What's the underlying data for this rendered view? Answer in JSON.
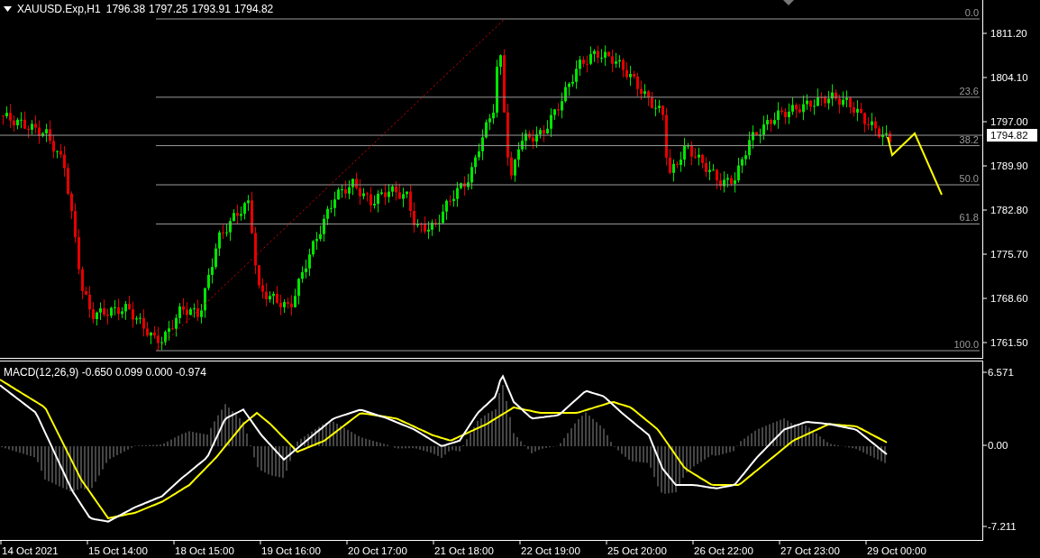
{
  "chart_header": {
    "instrument": "XAUUSD.Exp,H1",
    "ohlc": [
      "1796.38",
      "1797.25",
      "1793.91",
      "1794.82"
    ]
  },
  "price_axis": {
    "labels": [
      "1811.20",
      "1804.10",
      "1797.00",
      "1789.90",
      "1782.80",
      "1775.70",
      "1768.60",
      "1761.50"
    ],
    "current_price": "1794.82"
  },
  "fibonacci": {
    "levels": [
      {
        "label": "0.0"
      },
      {
        "label": "23.6"
      },
      {
        "label": "38.2"
      },
      {
        "label": "50.0"
      },
      {
        "label": "61.8"
      },
      {
        "label": "100.0"
      }
    ]
  },
  "macd": {
    "title": "MACD(12,26,9) -0.650 0.099 0.000 -0.974",
    "axis_labels": [
      "6.571",
      "0.00",
      "-7.211"
    ]
  },
  "time_axis": {
    "labels": [
      "14 Oct 2021",
      "15 Oct 14:00",
      "18 Oct 15:00",
      "19 Oct 16:00",
      "20 Oct 17:00",
      "21 Oct 18:00",
      "22 Oct 19:00",
      "25 Oct 20:00",
      "26 Oct 22:00",
      "27 Oct 23:00",
      "29 Oct 00:00"
    ]
  }
}
